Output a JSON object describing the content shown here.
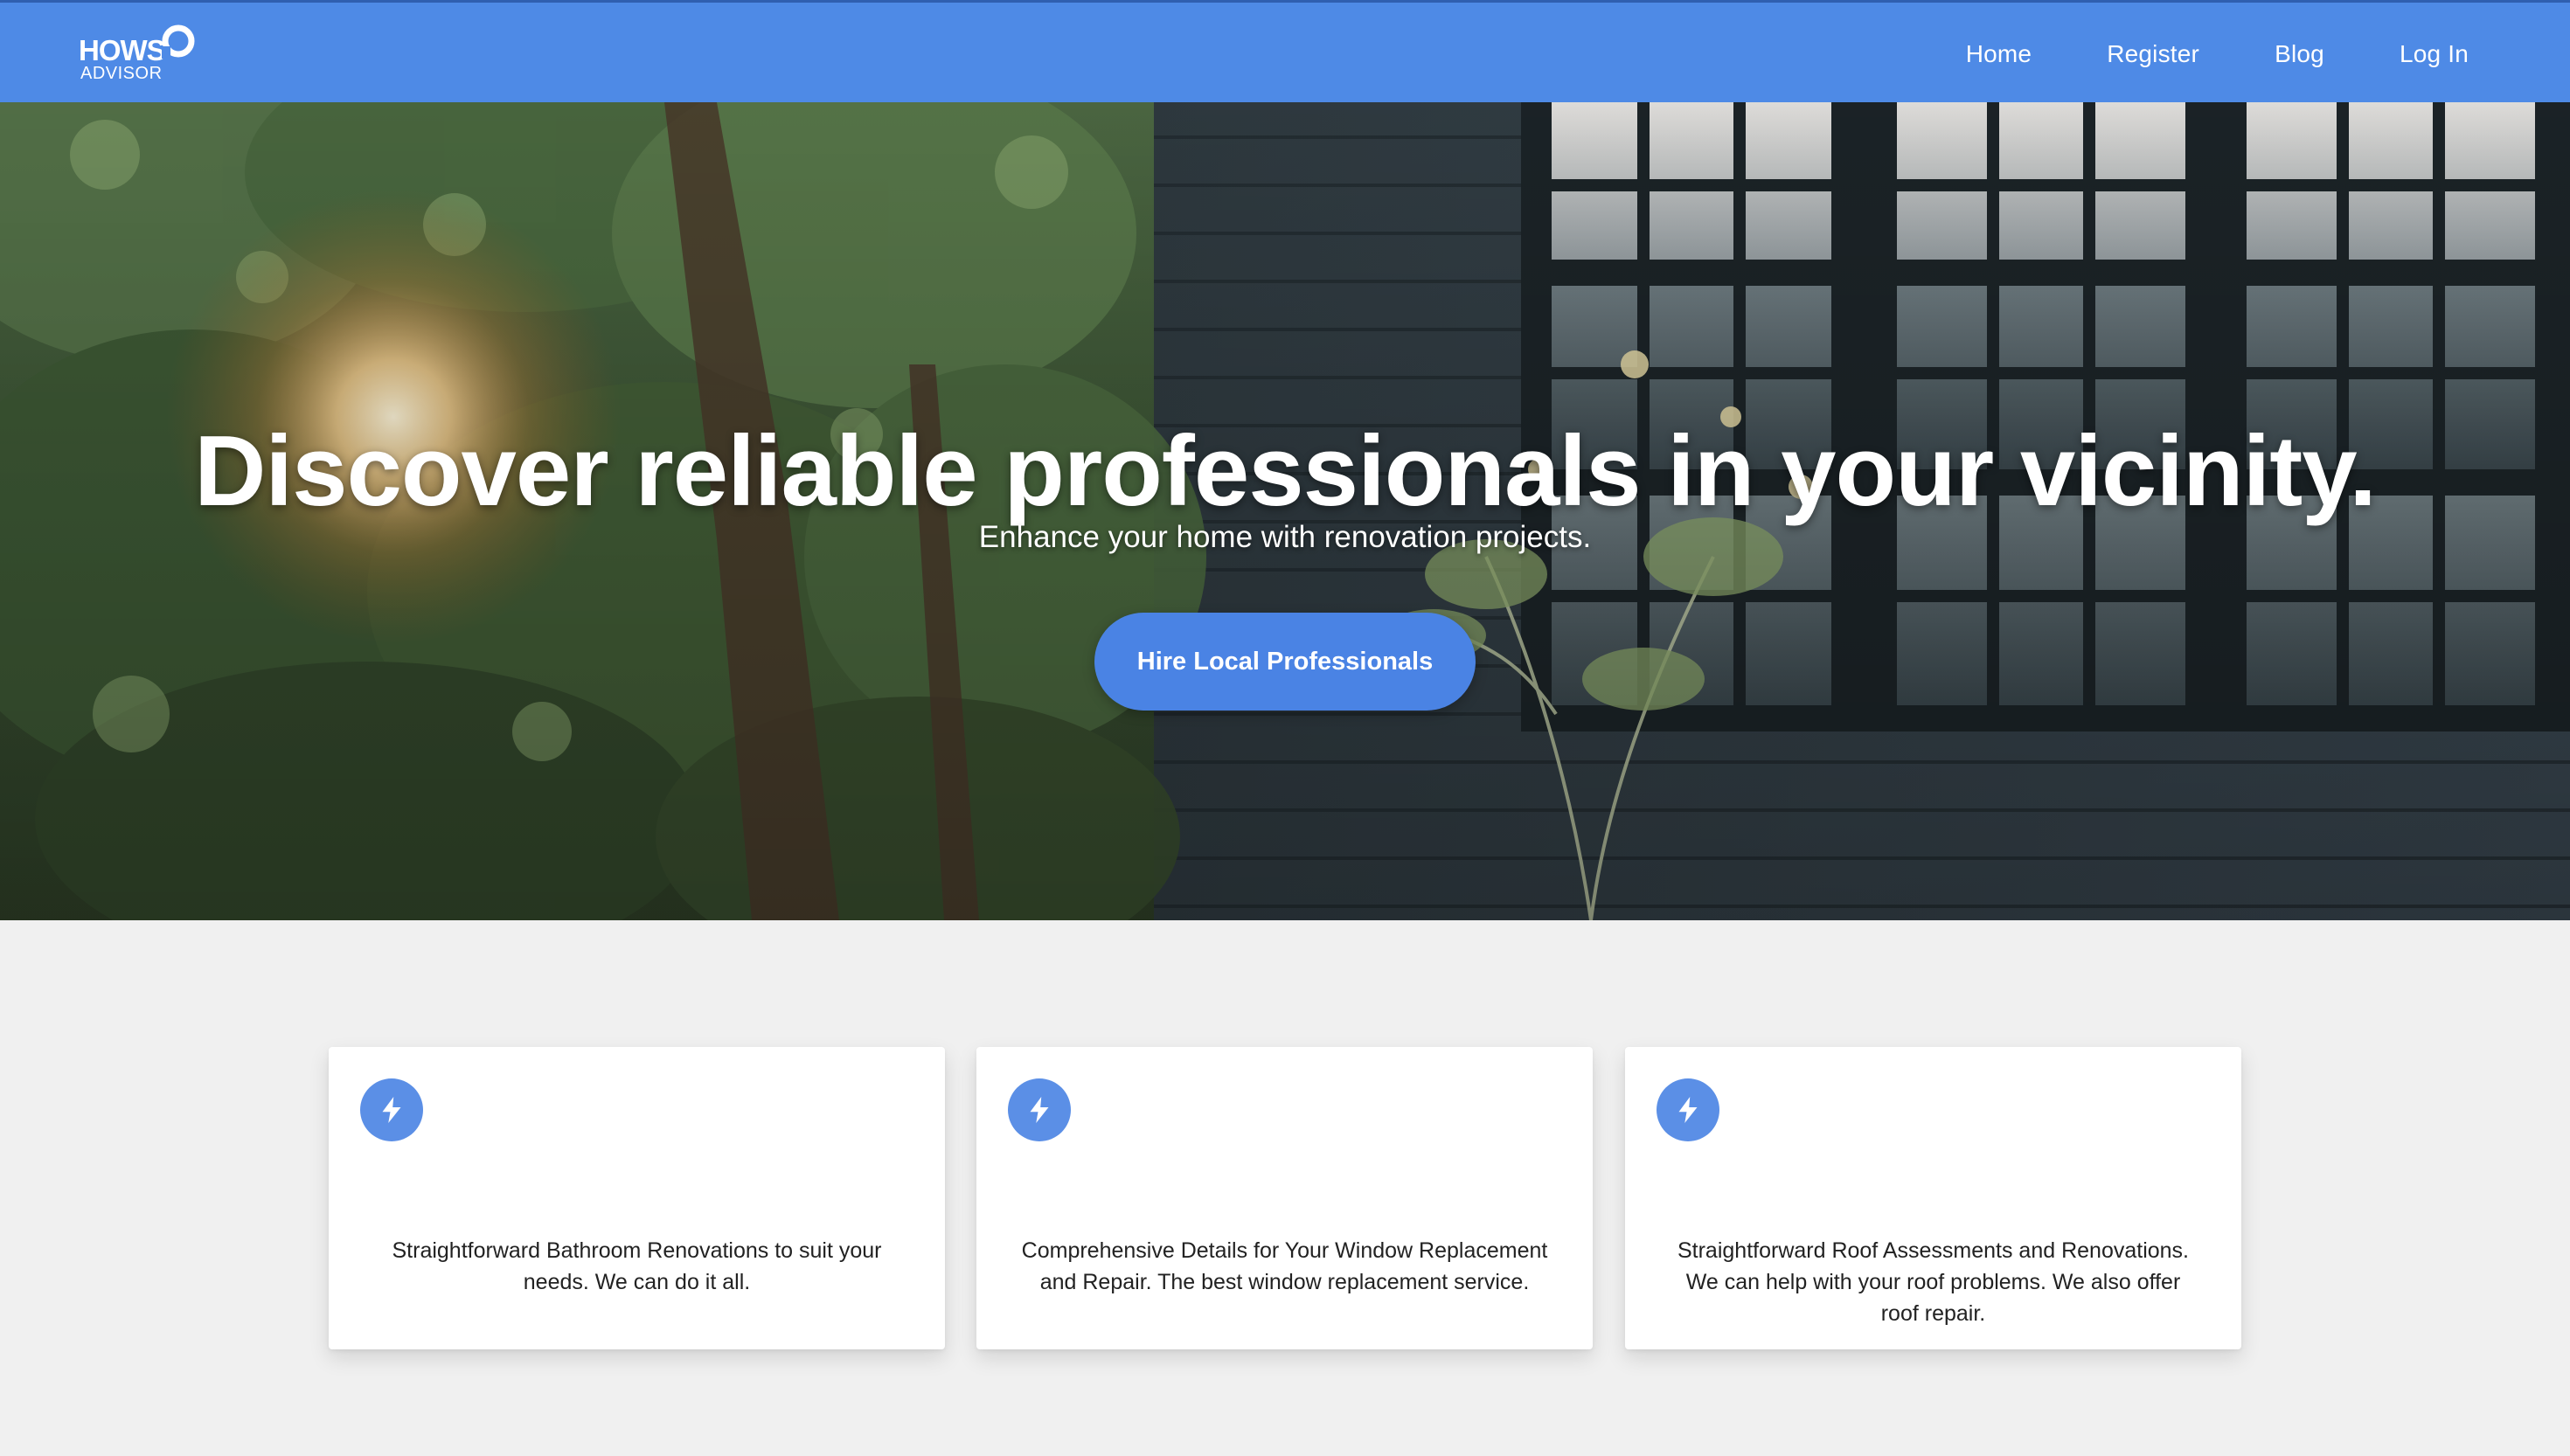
{
  "brand": {
    "logo_main": "HOWS",
    "logo_sub": "ADVISOR",
    "color": "#4e8ae6"
  },
  "nav": {
    "items": [
      {
        "label": "Home"
      },
      {
        "label": "Register"
      },
      {
        "label": "Blog"
      },
      {
        "label": "Log In"
      }
    ]
  },
  "hero": {
    "title": "Discover reliable professionals in your vicinity.",
    "subtitle": "Enhance your home with renovation projects.",
    "cta_label": "Hire Local Professionals",
    "background": "photo of a dark clapboard house with windows behind trees, sunlight"
  },
  "features": [
    {
      "icon": "lightning-bolt-icon",
      "text": "Straightforward Bathroom Renovations to suit your needs. We can do it all."
    },
    {
      "icon": "lightning-bolt-icon",
      "text": "Comprehensive Details for Your Window Replacement and Repair. The best window replacement service."
    },
    {
      "icon": "lightning-bolt-icon",
      "text": "Straightforward Roof Assessments and Renovations. We can help with your roof problems. We also offer roof repair."
    }
  ],
  "colors": {
    "accent": "#4a83e4",
    "page_background": "#f0f0f0",
    "card_background": "#ffffff",
    "icon_circle": "#5b8fe6"
  }
}
